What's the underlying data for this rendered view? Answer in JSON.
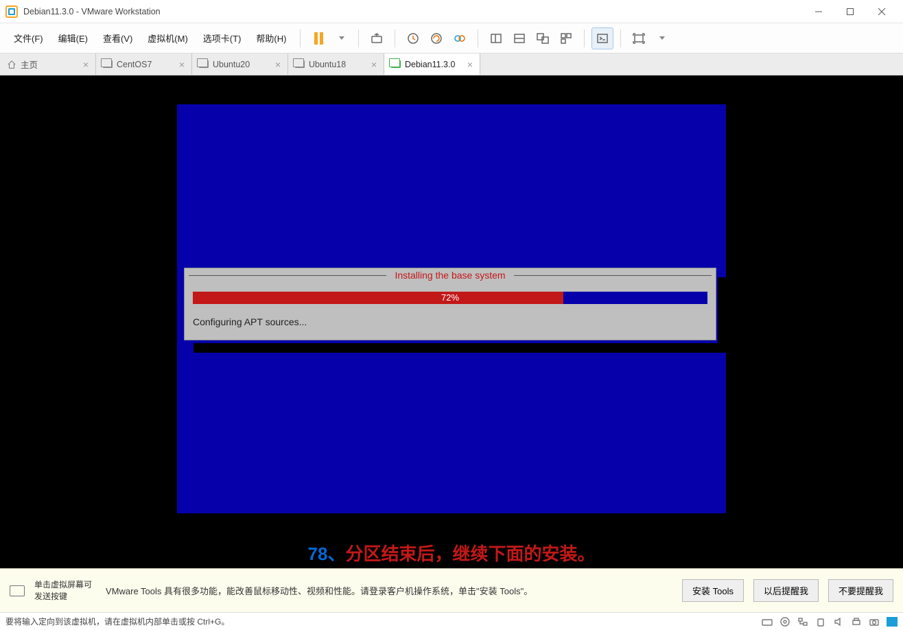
{
  "titlebar": {
    "title": "Debian11.3.0 - VMware Workstation"
  },
  "menus": {
    "file": "文件(F)",
    "edit": "编辑(E)",
    "view": "查看(V)",
    "vm": "虚拟机(M)",
    "tabs": "选项卡(T)",
    "help": "帮助(H)"
  },
  "tabs": [
    {
      "label": "主页",
      "home": true
    },
    {
      "label": "CentOS7"
    },
    {
      "label": "Ubuntu20"
    },
    {
      "label": "Ubuntu18"
    },
    {
      "label": "Debian11.3.0",
      "active": true
    }
  ],
  "installer": {
    "title": "Installing the base system",
    "progress_pct": 72,
    "progress_label": "72%",
    "status": "Configuring APT sources..."
  },
  "caption": {
    "num": "78、",
    "text": "分区结束后，继续下面的安装。"
  },
  "infobar": {
    "hint1": "单击虚拟屏幕可发送按键",
    "hint2": "VMware Tools 具有很多功能，能改善鼠标移动性、视频和性能。请登录客户机操作系统，单击\"安装 Tools\"。",
    "btn_install": "安装 Tools",
    "btn_later": "以后提醒我",
    "btn_never": "不要提醒我"
  },
  "statusbar": {
    "msg": "要将输入定向到该虚拟机，请在虚拟机内部单击或按 Ctrl+G。"
  }
}
